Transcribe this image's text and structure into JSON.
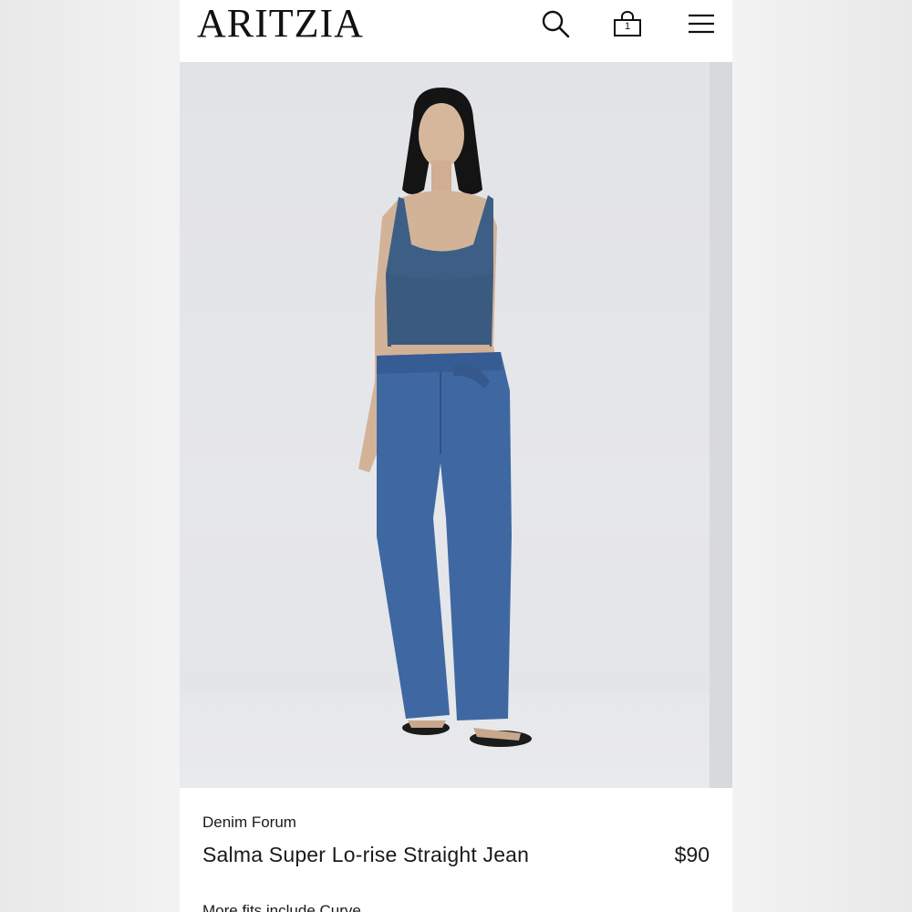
{
  "header": {
    "logo": "ARITZIA",
    "icons": [
      "search-icon",
      "shopping-bag-icon",
      "hamburger-menu-icon"
    ],
    "bag_count": "1"
  },
  "product": {
    "image": "product-photo",
    "brand": "Denim Forum",
    "name": "Salma Super Lo-rise Straight Jean",
    "price": "$90",
    "more_fits": "More fits include Curve"
  },
  "colors": {
    "text": "#1a1a1a",
    "denim": "#3f68a2",
    "top": "#3d5f86",
    "background": "#e4e5e8"
  }
}
